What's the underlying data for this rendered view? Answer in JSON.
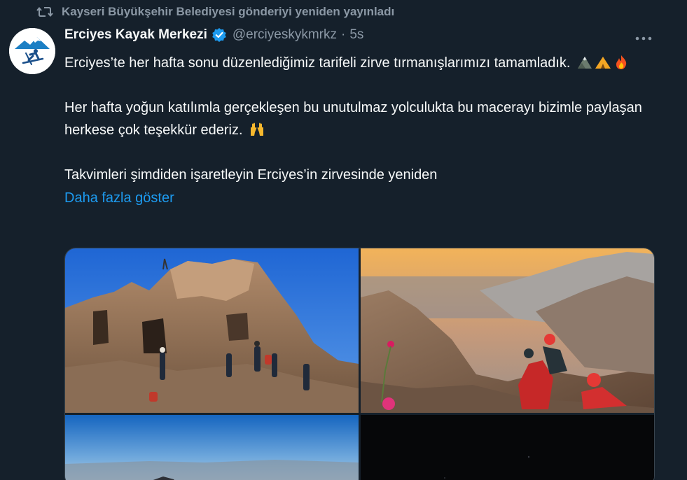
{
  "retweet": {
    "icon": "retweet-icon",
    "text": "Kayseri Büyükşehir Belediyesi gönderiyi yeniden yayınladı"
  },
  "author": {
    "avatar_icon": "erciyes-ski-logo",
    "name": "Erciyes Kayak Merkezi",
    "verified_icon": "verified-badge-icon",
    "handle": "@erciyeskykmrkz",
    "separator": "·",
    "time": "5s",
    "more_icon": "more-options-icon"
  },
  "tweet": {
    "paragraph1": "Erciyes’te her hafta sonu düzenlediğimiz tarifeli zirve tırmanışlarımızı tamamladık.",
    "paragraph1_emojis": [
      "mountain-emoji",
      "tent-emoji",
      "fire-emoji"
    ],
    "paragraph2": "Her hafta yoğun katılımla gerçekleşen bu unutulmaz yolculukta bu macerayı bizimle paylaşan herkese çok teşekkür ederiz.",
    "paragraph2_emojis": [
      "raised-hands-emoji"
    ],
    "paragraph3": "Takvimleri şimdiden işaretleyin Erciyes’in zirvesinde yeniden",
    "show_more": "Daha fazla göster"
  },
  "media": {
    "photos": [
      {
        "name": "photo-rocky-summit-climbers"
      },
      {
        "name": "photo-sunrise-valley-climbers"
      },
      {
        "name": "photo-sky-horizon"
      },
      {
        "name": "photo-dark-night"
      }
    ]
  },
  "colors": {
    "background": "#15202b",
    "text_primary": "#f7f9f9",
    "text_secondary": "#8b98a5",
    "link": "#1d9bf0",
    "border": "#38444d"
  }
}
